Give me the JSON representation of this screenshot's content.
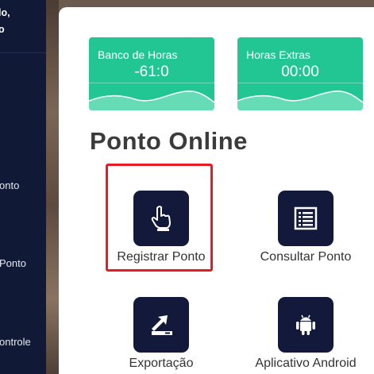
{
  "sidebar": {
    "greeting_line1": "lo,",
    "greeting_line2": "o",
    "items": [
      {
        "label": "onto"
      },
      {
        "label": "Ponto"
      },
      {
        "label": "ontrole"
      }
    ]
  },
  "cards": [
    {
      "title": "Banco de Horas",
      "value": "-61:0"
    },
    {
      "title": "Horas Extras",
      "value": "00:00"
    }
  ],
  "main": {
    "heading": "Ponto Online",
    "tiles": [
      {
        "label": "Registrar Ponto",
        "icon": "hand-pointer-icon",
        "highlighted": true
      },
      {
        "label": "Consultar Ponto",
        "icon": "list-document-icon"
      },
      {
        "label": "Exportação",
        "icon": "export-arrow-icon"
      },
      {
        "label": "Aplicativo Android",
        "icon": "android-icon"
      }
    ]
  },
  "colors": {
    "sidebar": "#101a36",
    "card_green": "#22c692",
    "tile_dark": "#13193a",
    "highlight_red": "#e51c23"
  }
}
